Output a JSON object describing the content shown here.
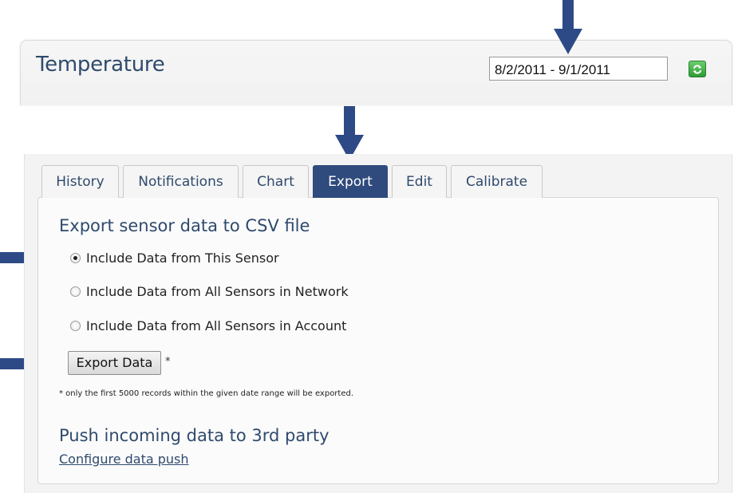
{
  "header": {
    "title": "Temperature",
    "date_range": "8/2/2011 - 9/1/2011"
  },
  "tabs": [
    {
      "label": "History",
      "active": false
    },
    {
      "label": "Notifications",
      "active": false
    },
    {
      "label": "Chart",
      "active": false
    },
    {
      "label": "Export",
      "active": true
    },
    {
      "label": "Edit",
      "active": false
    },
    {
      "label": "Calibrate",
      "active": false
    }
  ],
  "export": {
    "heading": "Export sensor data to CSV file",
    "options": [
      {
        "label": "Include Data from This Sensor",
        "selected": true
      },
      {
        "label": "Include Data from All Sensors in Network",
        "selected": false
      },
      {
        "label": "Include Data from All Sensors in Account",
        "selected": false
      }
    ],
    "button_label": "Export Data",
    "asterisk": "*",
    "footnote": "* only the first 5000 records within the given date range will be exported."
  },
  "push": {
    "heading": "Push incoming data to 3rd party",
    "link_label": "Configure data push"
  },
  "colors": {
    "accent": "#2f4a7c",
    "arrow": "#2e4a86",
    "refresh": "#3aa63f"
  },
  "icons": [
    "refresh-icon",
    "down-arrow-icon",
    "right-arrow-icon",
    "radio-icon"
  ]
}
